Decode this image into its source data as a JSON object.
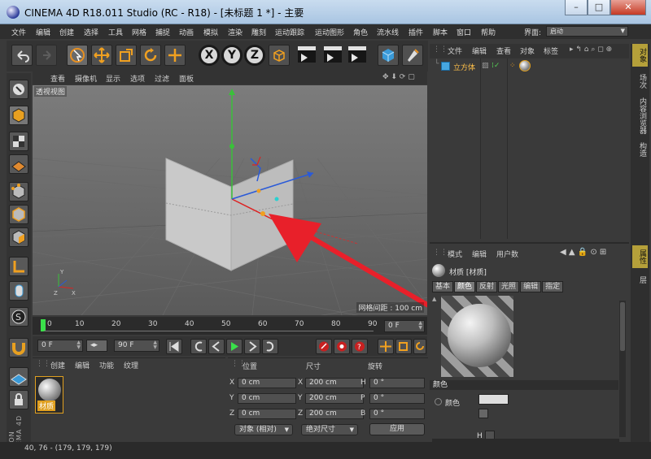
{
  "window": {
    "title": "CINEMA 4D R18.011 Studio (RC - R18) - [未标题 1 *] - 主要"
  },
  "menubar": {
    "items": [
      "文件",
      "编辑",
      "创建",
      "选择",
      "工具",
      "网格",
      "捕捉",
      "动画",
      "模拟",
      "渲染",
      "雕刻",
      "运动跟踪",
      "运动图形",
      "角色",
      "流水线",
      "插件",
      "脚本",
      "窗口",
      "帮助"
    ],
    "layout_label": "界面:",
    "layout_value": "启动"
  },
  "viewport": {
    "menu": [
      "查看",
      "摄像机",
      "显示",
      "选项",
      "过滤",
      "面板"
    ],
    "label": "透视视图",
    "grid_spacing": "网格间距 : 100 cm"
  },
  "timeline": {
    "ticks": [
      "0",
      "10",
      "20",
      "30",
      "40",
      "50",
      "60",
      "70",
      "80",
      "90"
    ],
    "end_frame": "0 F"
  },
  "transport": {
    "start": "0 F",
    "end": "90 F"
  },
  "material_panel": {
    "menu": [
      "创建",
      "编辑",
      "功能",
      "纹理"
    ],
    "material_name": "材质"
  },
  "coord_panel": {
    "headers": {
      "position": "位置",
      "size": "尺寸",
      "rotation": "旋转"
    },
    "rows": [
      {
        "axis": "X",
        "pos": "0 cm",
        "size_axis": "X",
        "size": "200 cm",
        "rot_axis": "H",
        "rot": "0 °"
      },
      {
        "axis": "Y",
        "pos": "0 cm",
        "size_axis": "Y",
        "size": "200 cm",
        "rot_axis": "P",
        "rot": "0 °"
      },
      {
        "axis": "Z",
        "pos": "0 cm",
        "size_axis": "Z",
        "size": "200 cm",
        "rot_axis": "B",
        "rot": "0 °"
      }
    ],
    "mode": "对象 (相对)",
    "size_mode": "绝对尺寸",
    "apply": "应用"
  },
  "status": {
    "text": "40, 76 - (179, 179, 179)"
  },
  "object_manager": {
    "menu": [
      "文件",
      "编辑",
      "查看",
      "对象",
      "标签"
    ],
    "object_name": "立方体"
  },
  "attribute_manager": {
    "menu": [
      "模式",
      "编辑",
      "用户数"
    ],
    "title": "材质 [材质]",
    "tabs": [
      "基本",
      "颜色",
      "反射",
      "光照",
      "编辑",
      "指定"
    ],
    "active_tab": "颜色",
    "section": "颜色",
    "color_label": "颜色",
    "h_label": "H"
  },
  "side_tabs": {
    "top": [
      "对象",
      "场次",
      "内容浏览器",
      "构造"
    ],
    "bottom": [
      "属性",
      "层"
    ]
  },
  "brand": {
    "vertical": "MAXON CINEMA 4D"
  },
  "colors": {
    "accent": "#e0a020",
    "selection": "#ffc04a",
    "arrow": "#e8202a"
  }
}
